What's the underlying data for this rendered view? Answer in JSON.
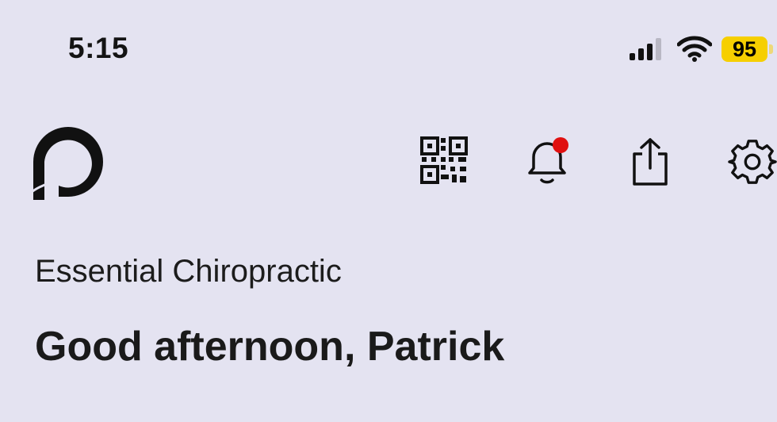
{
  "status_bar": {
    "time": "5:15",
    "battery": "95",
    "icons": [
      "signal-icon",
      "wifi-icon",
      "battery-icon"
    ]
  },
  "header": {
    "logo": "app-logo",
    "actions": [
      "qr-code-icon",
      "bell-icon",
      "share-icon",
      "gear-icon"
    ],
    "notification_dot_color": "#e01010"
  },
  "main": {
    "clinic_name": "Essential Chiropractic",
    "greeting": "Good afternoon, Patrick"
  },
  "colors": {
    "background": "#e4e3f1",
    "battery": "#f6cf00",
    "text": "#141414"
  }
}
